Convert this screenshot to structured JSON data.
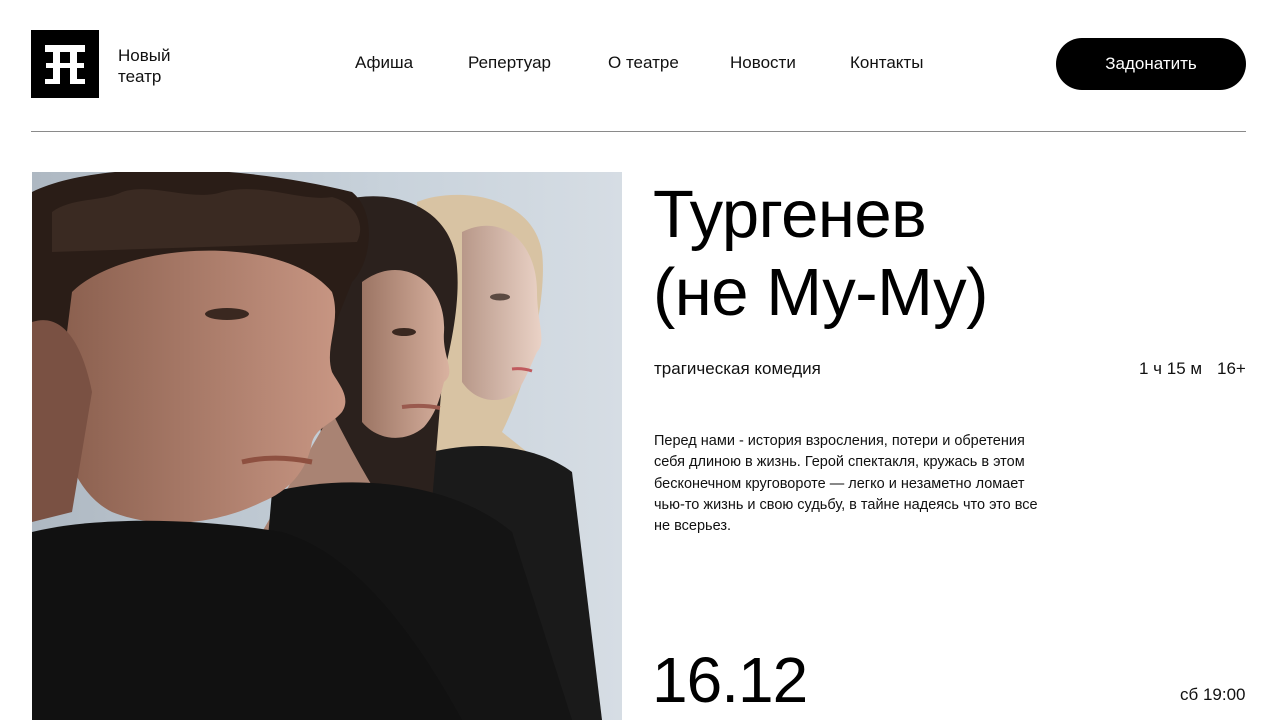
{
  "brand": {
    "line1": "Новый",
    "line2": "театр",
    "logo_icon": "theatre-logo-icon"
  },
  "nav": {
    "items": [
      {
        "label": "Афиша"
      },
      {
        "label": "Репертуар"
      },
      {
        "label": "О театре"
      },
      {
        "label": "Новости"
      },
      {
        "label": "Контакты"
      }
    ]
  },
  "donate_label": "Задонатить",
  "show": {
    "title_line1": "Тургенев",
    "title_line2": "(не Му-Му)",
    "genre": "трагическая комедия",
    "duration": "1 ч 15 м",
    "age_rating": "16+",
    "description": "Перед нами - история взросления, потери и обретения себя длиною в жизнь. Герой спектакля, кружась в этом бесконечном круговороте — легко и незаметно ломает чью-то жизнь и свою судьбу, в тайне надеясь что это все не всерьез.",
    "date": "16.12",
    "time": "сб 19:00"
  },
  "colors": {
    "background": "#ffffff",
    "text": "#000000",
    "button_bg": "#000000",
    "button_text": "#ffffff"
  }
}
